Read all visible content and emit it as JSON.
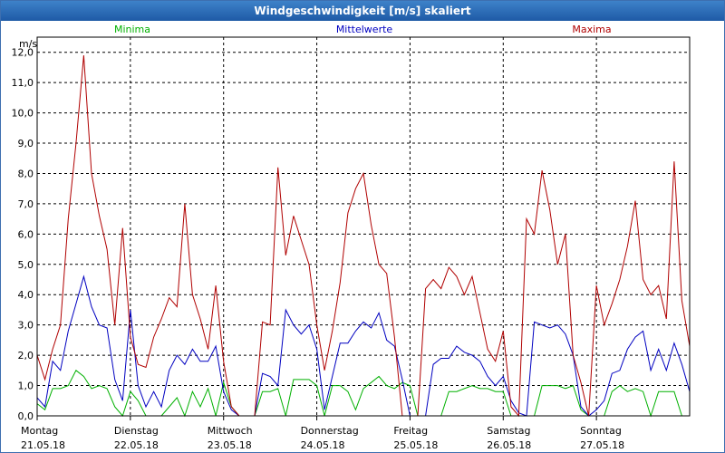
{
  "window": {
    "title": "Windgeschwindigkeit [m/s] skaliert"
  },
  "chart_data": {
    "type": "line",
    "ylabel": "m/s",
    "ylim": [
      0,
      12.5
    ],
    "xlim": [
      0,
      168
    ],
    "yticks": [
      "0,0",
      "1,0",
      "2,0",
      "3,0",
      "4,0",
      "5,0",
      "6,0",
      "7,0",
      "8,0",
      "9,0",
      "10,0",
      "11,0",
      "12,0"
    ],
    "xticks": [
      {
        "day": "Montag",
        "date": "21.05.18",
        "x": 0
      },
      {
        "day": "Dienstag",
        "date": "22.05.18",
        "x": 24
      },
      {
        "day": "Mittwoch",
        "date": "23.05.18",
        "x": 48
      },
      {
        "day": "Donnerstag",
        "date": "24.05.18",
        "x": 72
      },
      {
        "day": "Freitag",
        "date": "25.05.18",
        "x": 96
      },
      {
        "day": "Samstag",
        "date": "26.05.18",
        "x": 120
      },
      {
        "day": "Sonntag",
        "date": "27.05.18",
        "x": 144
      }
    ],
    "grid": true,
    "series": [
      {
        "name": "Minima",
        "color": "#00b000",
        "x": [
          0,
          2,
          4,
          6,
          8,
          10,
          12,
          14,
          16,
          18,
          20,
          22,
          24,
          26,
          28,
          30,
          32,
          34,
          36,
          38,
          40,
          42,
          44,
          46,
          48,
          50,
          52,
          54,
          56,
          58,
          60,
          62,
          64,
          66,
          68,
          70,
          72,
          74,
          76,
          78,
          80,
          82,
          84,
          86,
          88,
          90,
          92,
          94,
          96,
          98,
          100,
          102,
          104,
          106,
          108,
          110,
          112,
          114,
          116,
          118,
          120,
          122,
          124,
          126,
          128,
          130,
          132,
          134,
          136,
          138,
          140,
          142,
          144,
          146,
          148,
          150,
          152,
          154,
          156,
          158,
          160,
          162,
          164,
          166,
          168
        ],
        "values": [
          0.4,
          0.2,
          0.9,
          0.9,
          1.0,
          1.5,
          1.3,
          0.9,
          1.0,
          0.9,
          0.3,
          0.0,
          0.8,
          0.5,
          0.0,
          0.0,
          0.0,
          0.3,
          0.6,
          0.0,
          0.8,
          0.3,
          0.9,
          0.0,
          1.1,
          0.3,
          0.0,
          0.0,
          0.0,
          0.8,
          0.8,
          0.9,
          0.0,
          1.2,
          1.2,
          1.2,
          1.0,
          0.0,
          1.0,
          1.0,
          0.8,
          0.2,
          0.9,
          1.1,
          1.3,
          1.0,
          0.9,
          1.1,
          1.0,
          0.0,
          0.0,
          0.0,
          0.0,
          0.8,
          0.8,
          0.9,
          1.0,
          0.9,
          0.9,
          0.8,
          0.8,
          0.0,
          0.0,
          0.0,
          0.0,
          1.0,
          1.0,
          1.0,
          0.9,
          1.0,
          0.2,
          0.0,
          0.0,
          0.0,
          0.8,
          1.0,
          0.8,
          0.9,
          0.8,
          0.0,
          0.8,
          0.8,
          0.8,
          0.0,
          0.0
        ]
      },
      {
        "name": "Mittelwerte",
        "color": "#0000c0",
        "x": [
          0,
          2,
          4,
          6,
          8,
          10,
          12,
          14,
          16,
          18,
          20,
          22,
          24,
          26,
          28,
          30,
          32,
          34,
          36,
          38,
          40,
          42,
          44,
          46,
          48,
          50,
          52,
          54,
          56,
          58,
          60,
          62,
          64,
          66,
          68,
          70,
          72,
          74,
          76,
          78,
          80,
          82,
          84,
          86,
          88,
          90,
          92,
          94,
          96,
          98,
          100,
          102,
          104,
          106,
          108,
          110,
          112,
          114,
          116,
          118,
          120,
          122,
          124,
          126,
          128,
          130,
          132,
          134,
          136,
          138,
          140,
          142,
          144,
          146,
          148,
          150,
          152,
          154,
          156,
          158,
          160,
          162,
          164,
          166,
          168
        ],
        "values": [
          0.6,
          0.3,
          1.8,
          1.5,
          2.8,
          3.7,
          4.6,
          3.6,
          3.0,
          2.9,
          1.2,
          0.5,
          3.5,
          1.0,
          0.3,
          0.8,
          0.3,
          1.5,
          2.0,
          1.7,
          2.2,
          1.8,
          1.8,
          2.3,
          0.8,
          0.2,
          0.0,
          0.0,
          0.0,
          1.4,
          1.3,
          1.0,
          3.5,
          3.0,
          2.7,
          3.0,
          2.2,
          0.2,
          1.3,
          2.4,
          2.4,
          2.8,
          3.1,
          2.9,
          3.4,
          2.5,
          2.3,
          1.2,
          0.0,
          0.0,
          0.0,
          1.7,
          1.9,
          1.9,
          2.3,
          2.1,
          2.0,
          1.8,
          1.3,
          1.0,
          1.3,
          0.5,
          0.1,
          0.0,
          3.1,
          3.0,
          2.9,
          3.0,
          2.7,
          2.0,
          0.3,
          0.0,
          0.2,
          0.5,
          1.4,
          1.5,
          2.2,
          2.6,
          2.8,
          1.5,
          2.2,
          1.5,
          2.4,
          1.7,
          0.8
        ]
      },
      {
        "name": "Maxima",
        "color": "#b00000",
        "x": [
          0,
          2,
          4,
          6,
          8,
          10,
          12,
          14,
          16,
          18,
          20,
          22,
          24,
          26,
          28,
          30,
          32,
          34,
          36,
          38,
          40,
          42,
          44,
          46,
          48,
          50,
          52,
          54,
          56,
          58,
          60,
          62,
          64,
          66,
          68,
          70,
          72,
          74,
          76,
          78,
          80,
          82,
          84,
          86,
          88,
          90,
          92,
          94,
          96,
          98,
          100,
          102,
          104,
          106,
          108,
          110,
          112,
          114,
          116,
          118,
          120,
          122,
          124,
          126,
          128,
          130,
          132,
          134,
          136,
          138,
          140,
          142,
          144,
          146,
          148,
          150,
          152,
          154,
          156,
          158,
          160,
          162,
          164,
          166,
          168
        ],
        "values": [
          2.0,
          1.2,
          2.2,
          3.0,
          6.5,
          9.0,
          11.9,
          8.0,
          6.6,
          5.5,
          3.0,
          6.2,
          2.6,
          1.7,
          1.6,
          2.6,
          3.2,
          3.9,
          3.6,
          7.0,
          4.0,
          3.2,
          2.2,
          4.3,
          1.8,
          0.3,
          0.0,
          0.0,
          0.0,
          3.1,
          3.0,
          8.2,
          5.3,
          6.6,
          5.8,
          5.0,
          3.0,
          1.5,
          2.8,
          4.4,
          6.7,
          7.5,
          8.0,
          6.3,
          5.0,
          4.7,
          2.6,
          0.0,
          0.0,
          0.0,
          4.2,
          4.5,
          4.2,
          4.9,
          4.6,
          4.0,
          4.6,
          3.4,
          2.2,
          1.8,
          2.8,
          0.3,
          0.0,
          6.5,
          6.0,
          8.1,
          6.8,
          5.0,
          6.0,
          2.0,
          1.1,
          0.0,
          4.3,
          3.0,
          3.7,
          4.5,
          5.6,
          7.1,
          4.5,
          4.0,
          4.3,
          3.2,
          8.4,
          3.8,
          2.3
        ]
      }
    ]
  }
}
